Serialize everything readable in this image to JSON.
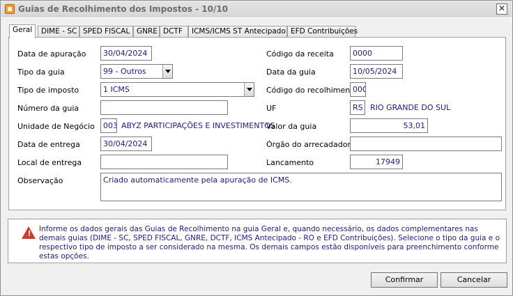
{
  "window": {
    "title": "Guias de Recolhimento dos Impostos - 10/10",
    "close_symbol": "✕"
  },
  "tabs": [
    {
      "label": "Geral"
    },
    {
      "label": "DIME - SC"
    },
    {
      "label": "SPED FISCAL"
    },
    {
      "label": "GNRE"
    },
    {
      "label": "DCTF"
    },
    {
      "label": "ICMS/ICMS ST Antecipado"
    },
    {
      "label": "EFD Contribuições"
    }
  ],
  "form": {
    "data_apuracao": {
      "label": "Data de apuração",
      "value": "30/04/2024"
    },
    "tipo_guia": {
      "label": "Tipo da guia",
      "value": "99 - Outros"
    },
    "tipo_imposto": {
      "label": "Tipo de imposto",
      "value": "1 ICMS"
    },
    "numero_guia": {
      "label": "Número da guia",
      "value": ""
    },
    "unidade_negocio": {
      "label": "Unidade de Negócio",
      "code": "003",
      "name": "ABYZ PARTICIPAÇÕES E INVESTIMENTOS"
    },
    "data_entrega": {
      "label": "Data de entrega",
      "value": "30/04/2024"
    },
    "local_entrega": {
      "label": "Local de entrega",
      "value": ""
    },
    "observacao": {
      "label": "Observação",
      "value": "Criado automaticamente pela apuração de ICMS."
    },
    "codigo_receita": {
      "label": "Código da receita",
      "value": "0000"
    },
    "data_guia": {
      "label": "Data da guia",
      "value": "10/05/2024"
    },
    "codigo_recolhimento": {
      "label": "Código do recolhimento",
      "value": "000"
    },
    "uf": {
      "label": "UF",
      "code": "RS",
      "name": "RIO GRANDE DO SUL"
    },
    "valor_guia": {
      "label": "Valor da guia",
      "value": "53,01"
    },
    "orgao_arrecadador": {
      "label": "Órgão do arrecadador",
      "value": ""
    },
    "lancamento": {
      "label": "Lancamento",
      "value": "17949"
    }
  },
  "info": {
    "icon": "warning-icon",
    "text": "Informe os dados gerais das Guias de Recolhimento na guia Geral e, quando necessário, os dados complementares nas demais guias (DIME - SC, SPED FISCAL, GNRE, DCTF, ICMS Antecipado - RO e EFD Contribuições). Selecione o tipo da guia e o respectivo tipo de imposto a ser considerado na mesma. Os demais campos estão disponíveis para preenchimento conforme estas opções."
  },
  "buttons": {
    "confirm": "Confirmar",
    "cancel": "Cancelar"
  },
  "colors": {
    "value_text": "#1a1a8c",
    "warning": "#d23b2a"
  }
}
